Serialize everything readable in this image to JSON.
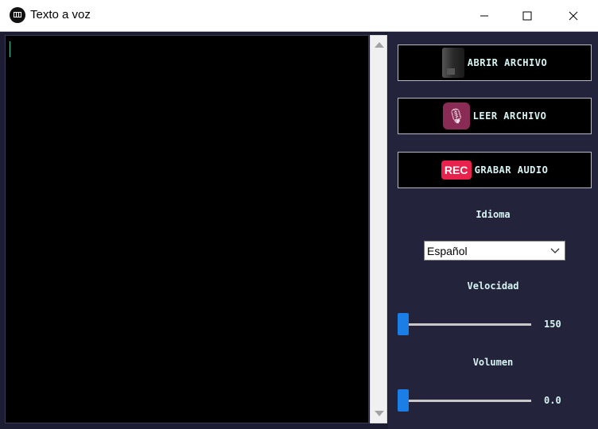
{
  "window": {
    "title": "Texto a voz"
  },
  "panel": {
    "buttons": [
      {
        "label": "ABRIR ARCHIVO",
        "icon": "folder-icon"
      },
      {
        "label": "LEER ARCHIVO",
        "icon": "microphone-icon"
      },
      {
        "label": "GRABAR AUDIO",
        "icon": "rec-icon",
        "icon_text": "REC"
      }
    ],
    "idioma": {
      "label": "Idioma",
      "selected": "Español"
    },
    "velocidad": {
      "label": "Velocidad",
      "value": "150",
      "level": 0
    },
    "volumen": {
      "label": "Volumen",
      "value": "0.0",
      "level": 0
    }
  },
  "colors": {
    "accent": "#1a7ee6",
    "background": "#1c1c33",
    "text": "#d6f4f2",
    "rec": "#e8214d"
  }
}
